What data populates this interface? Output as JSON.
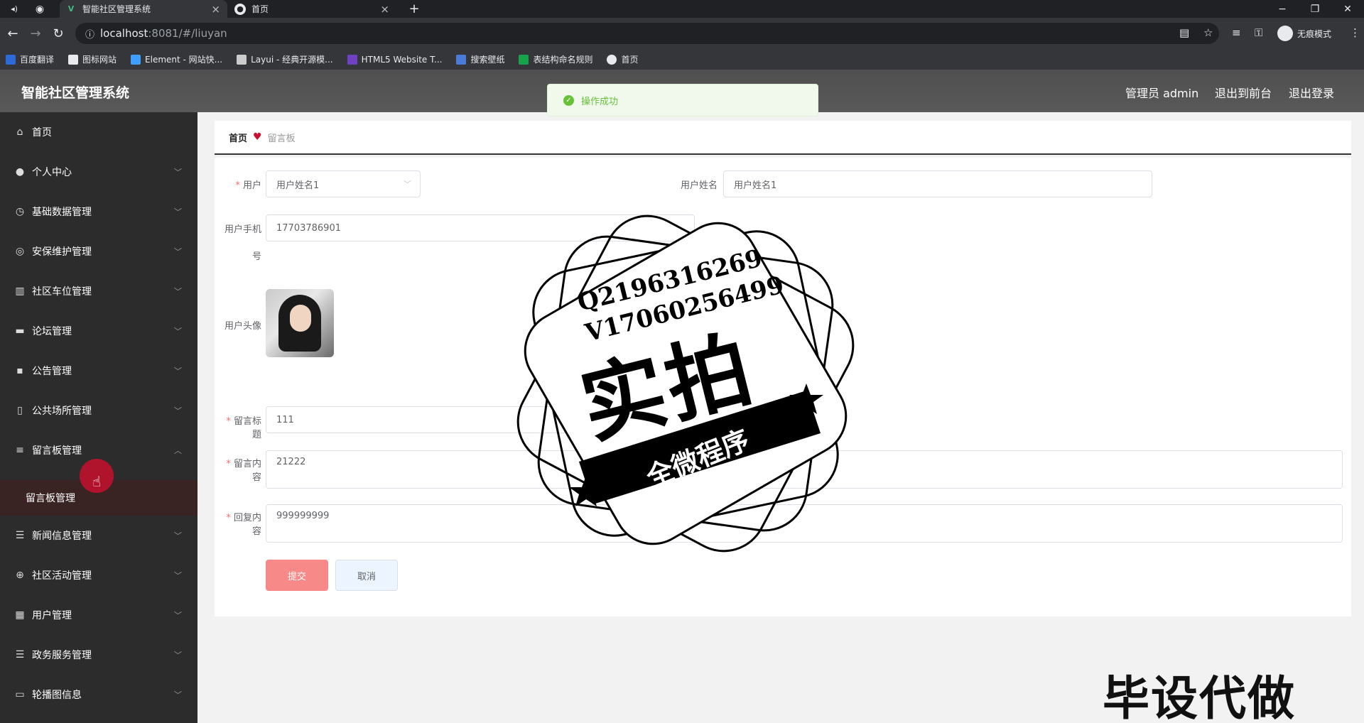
{
  "browser": {
    "tabs": [
      {
        "title": "智能社区管理系统",
        "active": true
      },
      {
        "title": "首页",
        "active": false
      }
    ],
    "url_host": "localhost",
    "url_path": ":8081/#/liuyan",
    "incognito_label": "无痕模式",
    "bookmarks": [
      {
        "label": "百度翻译",
        "color": "#2d6ad8"
      },
      {
        "label": "图标网站",
        "color": "#e8eaed"
      },
      {
        "label": "Element - 网站快...",
        "color": "#409eff"
      },
      {
        "label": "Layui - 经典开源模...",
        "color": "#cccccc"
      },
      {
        "label": "HTML5 Website T...",
        "color": "#6f42c1"
      },
      {
        "label": "搜索壁纸",
        "color": "#4a7bd8"
      },
      {
        "label": "表结构命名规则",
        "color": "#16a34a"
      },
      {
        "label": "首页",
        "color": "#e8eaed"
      }
    ]
  },
  "header": {
    "title": "智能社区管理系统",
    "admin_label": "管理员 admin",
    "to_front_label": "退出到前台",
    "logout_label": "退出登录"
  },
  "toast": {
    "message": "操作成功"
  },
  "sidebar": {
    "items": [
      {
        "label": "首页",
        "icon": "home-icon",
        "glyph": "⌂"
      },
      {
        "label": "个人中心",
        "icon": "user-icon",
        "glyph": "●"
      },
      {
        "label": "基础数据管理",
        "icon": "clock-icon",
        "glyph": "◷"
      },
      {
        "label": "安保维护管理",
        "icon": "shield-icon",
        "glyph": "◎"
      },
      {
        "label": "社区车位管理",
        "icon": "chart-icon",
        "glyph": "▥"
      },
      {
        "label": "论坛管理",
        "icon": "forum-icon",
        "glyph": "▬"
      },
      {
        "label": "公告管理",
        "icon": "message-icon",
        "glyph": "▪"
      },
      {
        "label": "公共场所管理",
        "icon": "mic-icon",
        "glyph": "▯"
      },
      {
        "label": "留言板管理",
        "icon": "filter-icon",
        "glyph": "≡"
      },
      {
        "label": "新闻信息管理",
        "icon": "list-icon",
        "glyph": "☰"
      },
      {
        "label": "社区活动管理",
        "icon": "globe-icon",
        "glyph": "⊕"
      },
      {
        "label": "用户管理",
        "icon": "users-icon",
        "glyph": "▦"
      },
      {
        "label": "政务服务管理",
        "icon": "menu-icon",
        "glyph": "☰"
      },
      {
        "label": "轮播图信息",
        "icon": "comment-icon",
        "glyph": "▭"
      }
    ],
    "sub_item": "留言板管理"
  },
  "breadcrumb": {
    "home": "首页",
    "current": "留言板"
  },
  "form": {
    "user_label": "用户",
    "user_value": "用户姓名1",
    "username_label": "用户姓名",
    "username_value": "用户姓名1",
    "phone_label_1": "用户手机",
    "phone_label_2": "号",
    "phone_value": "17703786901",
    "avatar_label": "用户头像",
    "title_label": "留言标题",
    "title_value": "111",
    "content_label": "留言内容",
    "content_value": "21222",
    "reply_label": "回复内容",
    "reply_value": "999999999",
    "submit_label": "提交",
    "cancel_label": "取消"
  },
  "watermark": {
    "contact_1": "Q2196316269",
    "contact_2": "V17060256499",
    "main": "实拍",
    "ribbon": "全微程序",
    "corner": "毕设代做"
  }
}
